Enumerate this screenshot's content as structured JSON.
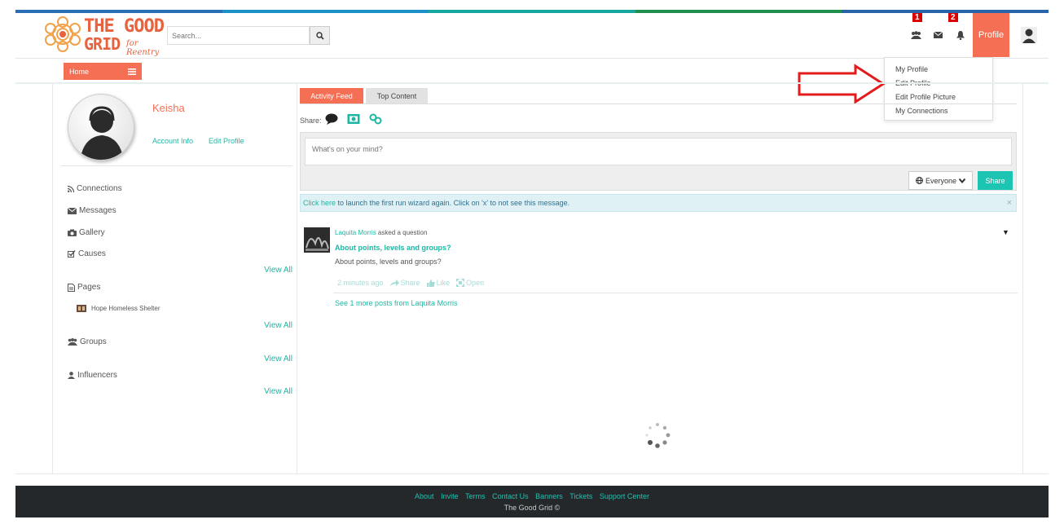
{
  "brand": {
    "logo_line1": "THE GOOD",
    "logo_line2": "GRID",
    "logo_line3": "for Reentry",
    "colors": {
      "accent": "#f56f55",
      "teal": "#1bb7a4",
      "footer": "#24282b"
    }
  },
  "search": {
    "placeholder": "Search..."
  },
  "topnav": {
    "badge1": "1",
    "badge2": "2",
    "profile_label": "Profile",
    "icons": [
      "groups-icon",
      "envelope-icon",
      "bell-icon"
    ]
  },
  "profile_menu": {
    "items": [
      "My Profile",
      "Edit Profile",
      "Edit Profile Picture",
      "My Connections"
    ]
  },
  "home": {
    "label": "Home"
  },
  "user": {
    "name": "Keisha",
    "account_info": "Account Info",
    "edit_profile": "Edit Profile"
  },
  "sidebar": {
    "connections": "Connections",
    "messages": "Messages",
    "gallery": "Gallery",
    "causes": "Causes",
    "pages": "Pages",
    "page_item": "Hope Homeless Shelter",
    "groups": "Groups",
    "influencers": "Influencers",
    "view_all": "View All"
  },
  "feed": {
    "tab_active": "Activity Feed",
    "tab_inactive": "Top Content",
    "share_label": "Share:",
    "composer_placeholder": "What's on your mind?",
    "audience": "Everyone",
    "share_button": "Share",
    "notice_link": "Click here",
    "notice_text": " to launch the first run wizard again. Click on 'x' to not see this message.",
    "notice_close": "×"
  },
  "post": {
    "author": "Laquita Morris",
    "action": " asked a question",
    "title": "About points, levels and groups?",
    "body": "About points, levels and groups?",
    "time": "2 minutes ago",
    "share": "Share",
    "like": "Like",
    "open": "Open",
    "more": "See 1 more posts from Laquita Morris"
  },
  "footer": {
    "links": [
      "About",
      "Invite",
      "Terms",
      "Contact Us",
      "Banners",
      "Tickets",
      "Support Center"
    ],
    "copyright": "The Good Grid ©"
  }
}
